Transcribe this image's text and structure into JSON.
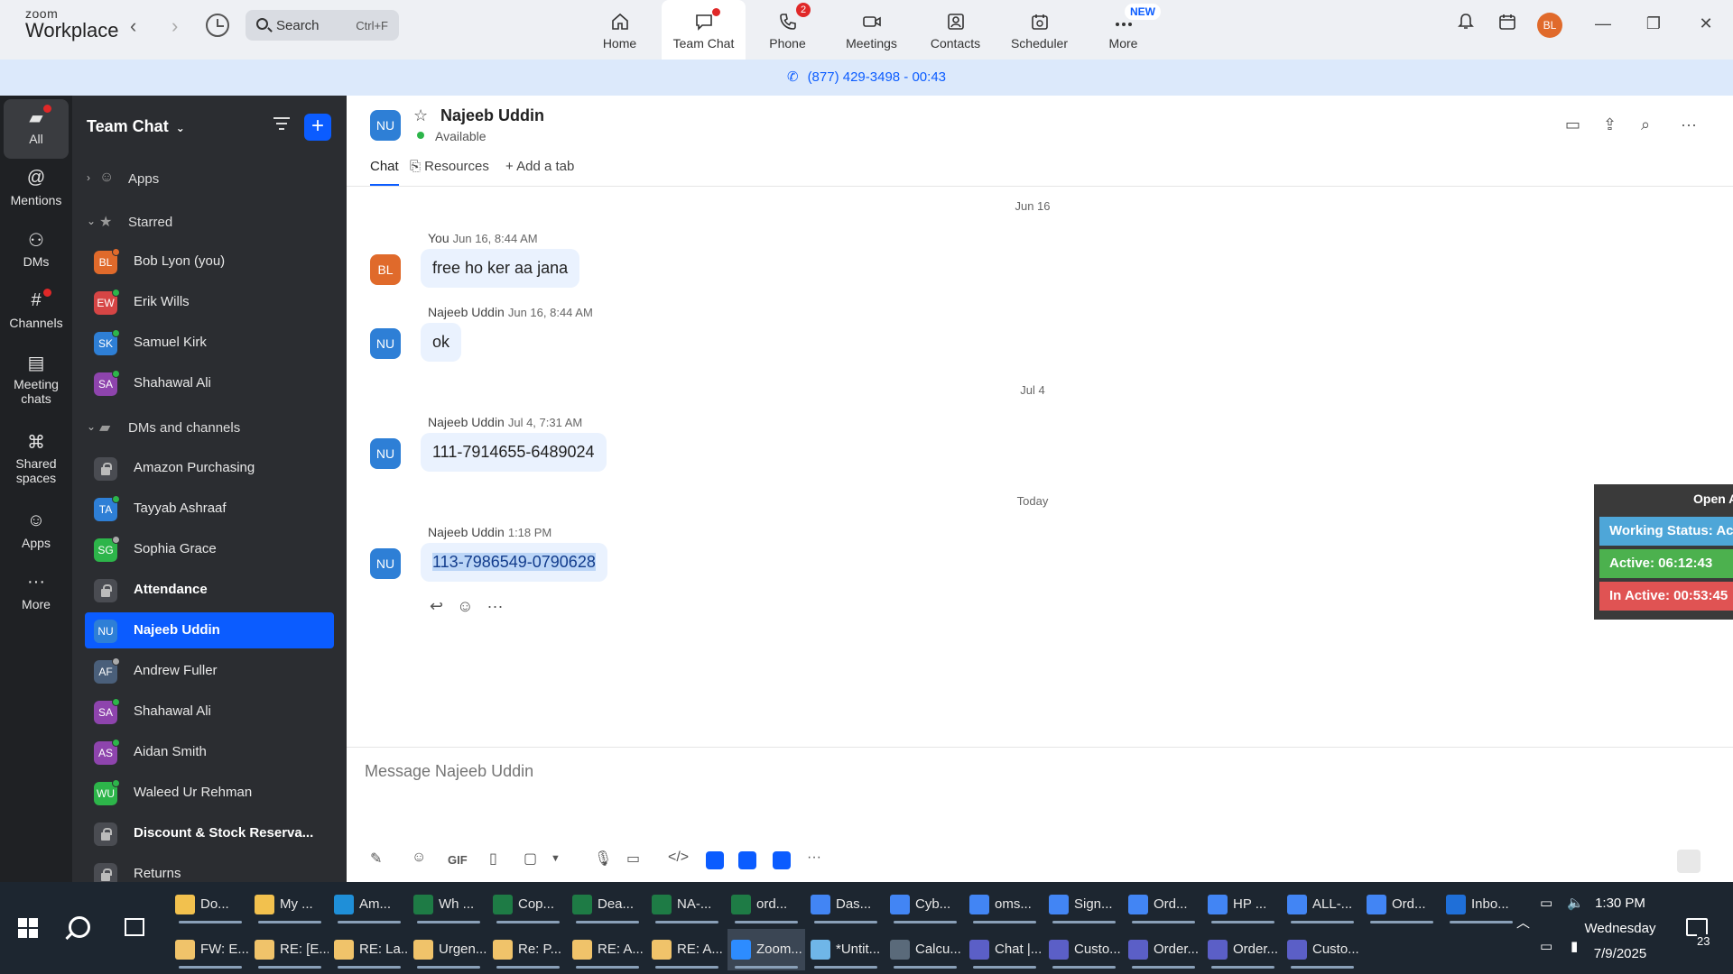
{
  "app": {
    "logo_top": "zoom",
    "logo_bottom": "Workplace"
  },
  "search": {
    "label": "Search",
    "shortcut": "Ctrl+F"
  },
  "tabs": [
    {
      "label": "Home",
      "icon": "home-icon"
    },
    {
      "label": "Team Chat",
      "icon": "chat-icon",
      "active": true
    },
    {
      "label": "Phone",
      "icon": "phone-icon",
      "badge": "2"
    },
    {
      "label": "Meetings",
      "icon": "video-icon"
    },
    {
      "label": "Contacts",
      "icon": "contacts-icon"
    },
    {
      "label": "Scheduler",
      "icon": "scheduler-icon"
    },
    {
      "label": "More",
      "icon": "more-icon",
      "new_badge": "NEW"
    }
  ],
  "user_avatar": "BL",
  "call_banner": "(877) 429-3498 - 00:43",
  "rail": [
    {
      "label": "All",
      "icon": "chat-bubble-icon"
    },
    {
      "label": "Mentions",
      "icon": "at-icon"
    },
    {
      "label": "DMs",
      "icon": "people-icon"
    },
    {
      "label": "Channels",
      "icon": "hash-icon"
    },
    {
      "label": "Meeting chats",
      "icon": "calendar-icon"
    },
    {
      "label": "Shared spaces",
      "icon": "share-icon"
    },
    {
      "label": "Apps",
      "icon": "apps-icon"
    },
    {
      "label": "More",
      "icon": "ellipsis-icon"
    }
  ],
  "sidebar": {
    "title": "Team Chat",
    "sections": {
      "apps": "Apps",
      "starred": "Starred",
      "dms": "DMs and channels"
    },
    "starred": [
      {
        "initials": "BL",
        "name": "Bob Lyon (you)",
        "color": "#e06a2b"
      },
      {
        "initials": "EW",
        "name": "Erik Wills",
        "color": "#d64545"
      },
      {
        "initials": "SK",
        "name": "Samuel Kirk",
        "color": "#2e7fd6"
      },
      {
        "initials": "SA",
        "name": "Shahawal Ali",
        "color": "#8e44ad"
      }
    ],
    "dms": [
      {
        "name": "Amazon Purchasing",
        "lock": true
      },
      {
        "initials": "TA",
        "name": "Tayyab Ashraaf",
        "color": "#2e7fd6"
      },
      {
        "initials": "SG",
        "name": "Sophia Grace",
        "color": "#2db54a"
      },
      {
        "name": "Attendance",
        "lock": true,
        "bold": true
      },
      {
        "initials": "NU",
        "name": "Najeeb Uddin",
        "color": "#2e7fd6",
        "selected": true
      },
      {
        "initials": "AF",
        "name": "Andrew Fuller",
        "color": "#4a5f7a"
      },
      {
        "initials": "SA",
        "name": "Shahawal Ali",
        "color": "#8e44ad"
      },
      {
        "initials": "AS",
        "name": "Aidan Smith",
        "color": "#8e44ad"
      },
      {
        "initials": "WU",
        "name": "Waleed Ur Rehman",
        "color": "#2db54a"
      },
      {
        "name": "Discount & Stock Reserva...",
        "lock": true,
        "bold": true
      },
      {
        "name": "Returns",
        "lock": true
      }
    ]
  },
  "chat": {
    "contact_initials": "NU",
    "contact_name": "Najeeb Uddin",
    "status": "Available",
    "tabs": [
      "Chat",
      "Resources",
      "Add a tab"
    ],
    "dates": [
      "Jun 16",
      "Jul 4",
      "Today"
    ],
    "messages": [
      {
        "initials": "BL",
        "color": "#e06a2b",
        "sender": "You",
        "time": "Jun 16, 8:44 AM",
        "text": "free ho ker aa jana"
      },
      {
        "initials": "NU",
        "color": "#2e7fd6",
        "sender": "Najeeb Uddin",
        "time": "Jun 16, 8:44 AM",
        "text": "ok"
      },
      {
        "initials": "NU",
        "color": "#2e7fd6",
        "sender": "Najeeb Uddin",
        "time": "Jul 4, 7:31 AM",
        "text": "111-7914655-6489024"
      },
      {
        "initials": "NU",
        "color": "#2e7fd6",
        "sender": "Najeeb Uddin",
        "time": "1:18 PM",
        "text": "113-7986549-0790628"
      }
    ],
    "composer_placeholder": "Message Najeeb Uddin"
  },
  "work_status": {
    "open_label": "Open A",
    "status": "Working Status: Ac",
    "active": "Active: 06:12:43",
    "inactive": "In Active: 00:53:45"
  },
  "taskbar": {
    "row1": [
      {
        "label": "Do...",
        "color": "#f2c14e"
      },
      {
        "label": "My ...",
        "color": "#f2c14e"
      },
      {
        "label": "Am...",
        "color": "#1f8fd8"
      },
      {
        "label": "Wh ...",
        "color": "#1e7b45"
      },
      {
        "label": "Cop...",
        "color": "#1e7b45"
      },
      {
        "label": "Dea...",
        "color": "#1e7b45"
      },
      {
        "label": "NA-...",
        "color": "#1e7b45"
      },
      {
        "label": "ord...",
        "color": "#1e7b45"
      },
      {
        "label": "Das...",
        "color": "#4285f4"
      },
      {
        "label": "Cyb...",
        "color": "#4285f4"
      },
      {
        "label": "oms...",
        "color": "#4285f4"
      },
      {
        "label": "Sign...",
        "color": "#4285f4"
      },
      {
        "label": "Ord...",
        "color": "#4285f4"
      },
      {
        "label": "HP ...",
        "color": "#4285f4"
      },
      {
        "label": "ALL-...",
        "color": "#4285f4"
      },
      {
        "label": "Ord...",
        "color": "#4285f4"
      },
      {
        "label": "Inbo...",
        "color": "#1f6fd8"
      }
    ],
    "row2": [
      {
        "label": "FW: E...",
        "color": "#f0c36a"
      },
      {
        "label": "RE: [E...",
        "color": "#f0c36a"
      },
      {
        "label": "RE: La...",
        "color": "#f0c36a"
      },
      {
        "label": "Urgen...",
        "color": "#f0c36a"
      },
      {
        "label": "Re: P...",
        "color": "#f0c36a"
      },
      {
        "label": "RE: A...",
        "color": "#f0c36a"
      },
      {
        "label": "RE: A...",
        "color": "#f0c36a"
      },
      {
        "label": "Zoom...",
        "color": "#2d8cff",
        "active": true
      },
      {
        "label": "*Untit...",
        "color": "#6fb6e8"
      },
      {
        "label": "Calcu...",
        "color": "#5a6a7a"
      },
      {
        "label": "Chat |...",
        "color": "#5b5fc7"
      },
      {
        "label": "Custo...",
        "color": "#5b5fc7"
      },
      {
        "label": "Order...",
        "color": "#5b5fc7"
      },
      {
        "label": "Order...",
        "color": "#5b5fc7"
      },
      {
        "label": "Custo...",
        "color": "#5b5fc7"
      }
    ],
    "time": "1:30 PM",
    "day": "Wednesday",
    "date": "7/9/2025",
    "notifications": "23"
  }
}
